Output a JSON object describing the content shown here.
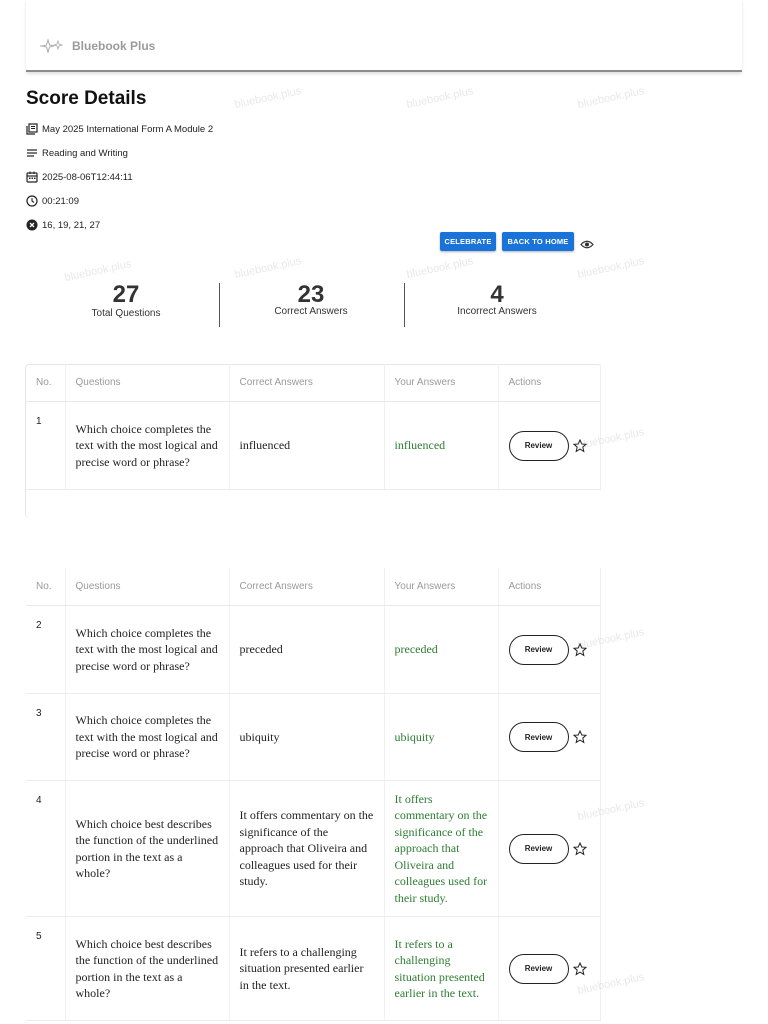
{
  "brand": {
    "name": "Bluebook Plus"
  },
  "page": {
    "title": "Score Details"
  },
  "meta": {
    "test_name": "May 2025 International Form A Module 2",
    "section": "Reading and Writing",
    "datetime": "2025-08-06T12:44:11",
    "duration": "00:21:09",
    "incorrect_list": "16, 19, 21, 27"
  },
  "buttons": {
    "celebrate": "CELEBRATE",
    "back_home": "BACK TO HOME",
    "review": "Review"
  },
  "stats": {
    "total": {
      "value": "27",
      "label": "Total Questions"
    },
    "correct": {
      "value": "23",
      "label": "Correct Answers"
    },
    "incorrect": {
      "value": "4",
      "label": "Incorrect Answers"
    }
  },
  "table": {
    "headers": {
      "no": "No.",
      "questions": "Questions",
      "correct": "Correct Answers",
      "yours": "Your Answers",
      "actions": "Actions"
    },
    "rows": [
      {
        "no": "1",
        "question": "Which choice completes the text with the most logical and precise word or phrase?",
        "correct": "influenced",
        "yours": "influenced"
      },
      {
        "no": "2",
        "question": "Which choice completes the text with the most logical and precise word or phrase?",
        "correct": "preceded",
        "yours": "preceded"
      },
      {
        "no": "3",
        "question": "Which choice completes the text with the most logical and precise word or phrase?",
        "correct": "ubiquity",
        "yours": "ubiquity"
      },
      {
        "no": "4",
        "question": "Which choice best describes the function of the underlined portion in the text as a whole?",
        "correct": "It offers commentary on the significance of the approach that Oliveira and colleagues used for their study.",
        "yours": "It offers commentary on the significance of the approach that Oliveira and colleagues used for their study."
      },
      {
        "no": "5",
        "question": "Which choice best describes the function of the underlined portion in the text as a whole?",
        "correct": "It refers to a challenging situation presented earlier in the text.",
        "yours": "It refers to a challenging situation presented earlier in the text."
      }
    ]
  },
  "watermark": "bluebook.plus",
  "colors": {
    "accent": "#1a73d9",
    "correct_text": "#2e7d32"
  }
}
